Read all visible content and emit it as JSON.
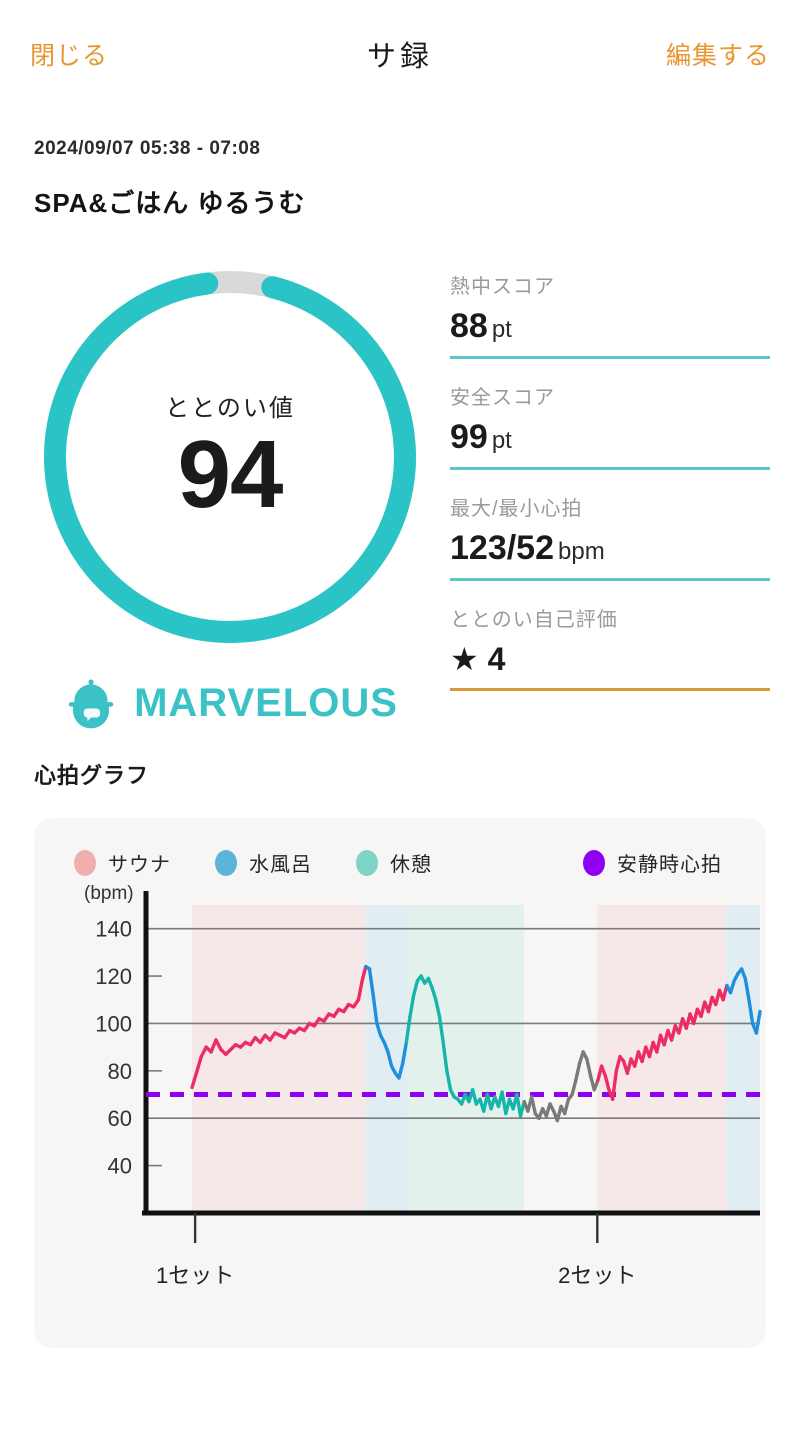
{
  "header": {
    "close_label": "閉じる",
    "title": "サ録",
    "edit_label": "編集する"
  },
  "session": {
    "datetime": "2024/09/07 05:38 - 07:08",
    "venue": "SPA&ごはん ゆるうむ"
  },
  "gauge": {
    "label": "ととのい値",
    "value": "94",
    "percent": 94,
    "track_color": "#D9D9D9",
    "fill_color": "#2BC4C6",
    "rank_text": "MARVELOUS",
    "rank_color": "#3BC2C6",
    "icon": "sauna-hat-character-icon"
  },
  "stats": [
    {
      "label": "熱中スコア",
      "value": "88",
      "unit": "pt",
      "rule_color": "#5CC6C8"
    },
    {
      "label": "安全スコア",
      "value": "99",
      "unit": "pt",
      "rule_color": "#5CC6C8"
    },
    {
      "label": "最大/最小心拍",
      "value": "123/52",
      "unit": "bpm",
      "rule_color": "#5CC6C8"
    },
    {
      "label": "ととのい自己評価",
      "value": "★ 4",
      "unit": "",
      "rule_color": "#D99A3E"
    }
  ],
  "chart_section_title": "心拍グラフ",
  "chart_data": {
    "type": "line",
    "title": "心拍グラフ",
    "ylabel": "(bpm)",
    "xlabel": "",
    "ylim": [
      20,
      150
    ],
    "yticks": [
      40,
      60,
      80,
      100,
      120,
      140
    ],
    "gridlines": [
      60,
      100,
      140
    ],
    "grid": true,
    "legend_position": "top",
    "legend": [
      {
        "name": "サウナ",
        "color": "#EFAFAF"
      },
      {
        "name": "水風呂",
        "color": "#5BB4D9"
      },
      {
        "name": "休憩",
        "color": "#7FD4C8"
      },
      {
        "name": "安静時心拍",
        "color": "#9000F0"
      }
    ],
    "xticks": [
      {
        "label": "1セット",
        "x": 0.08
      },
      {
        "label": "2セット",
        "x": 0.735
      }
    ],
    "resting_hr": 70,
    "resting_hr_color": "#9000F0",
    "phases": [
      {
        "type": "サウナ",
        "x0": 0.075,
        "x1": 0.358,
        "band_color": "#F6DDDE",
        "line_color": "#ED2C64"
      },
      {
        "type": "水風呂",
        "x0": 0.358,
        "x1": 0.425,
        "band_color": "#CDE6F2",
        "line_color": "#1E8FDE"
      },
      {
        "type": "休憩",
        "x0": 0.425,
        "x1": 0.615,
        "band_color": "#D3EDE8",
        "line_color": "#15B5AA"
      },
      {
        "type": "gap",
        "x0": 0.615,
        "x1": 0.735,
        "band_color": "#F7F6F4",
        "line_color": "#7A7A7A"
      },
      {
        "type": "サウナ",
        "x0": 0.735,
        "x1": 0.945,
        "band_color": "#F6DDDE",
        "line_color": "#ED2C64"
      },
      {
        "type": "水風呂",
        "x0": 0.945,
        "x1": 1.0,
        "band_color": "#CDE6F2",
        "line_color": "#1E8FDE"
      }
    ],
    "series": [
      {
        "name": "心拍数",
        "x": [
          0.075,
          0.082,
          0.09,
          0.098,
          0.106,
          0.114,
          0.122,
          0.13,
          0.138,
          0.146,
          0.154,
          0.162,
          0.17,
          0.178,
          0.186,
          0.194,
          0.202,
          0.21,
          0.218,
          0.226,
          0.234,
          0.242,
          0.25,
          0.258,
          0.266,
          0.274,
          0.282,
          0.29,
          0.298,
          0.306,
          0.314,
          0.322,
          0.33,
          0.338,
          0.346,
          0.352,
          0.358,
          0.364,
          0.37,
          0.376,
          0.382,
          0.388,
          0.394,
          0.4,
          0.406,
          0.412,
          0.418,
          0.424,
          0.43,
          0.436,
          0.442,
          0.448,
          0.454,
          0.46,
          0.466,
          0.472,
          0.478,
          0.484,
          0.49,
          0.496,
          0.502,
          0.508,
          0.514,
          0.52,
          0.526,
          0.532,
          0.538,
          0.544,
          0.55,
          0.556,
          0.562,
          0.568,
          0.574,
          0.58,
          0.586,
          0.592,
          0.598,
          0.604,
          0.61,
          0.616,
          0.622,
          0.628,
          0.634,
          0.64,
          0.646,
          0.652,
          0.658,
          0.664,
          0.67,
          0.676,
          0.682,
          0.688,
          0.694,
          0.7,
          0.706,
          0.712,
          0.718,
          0.724,
          0.73,
          0.736,
          0.742,
          0.748,
          0.754,
          0.76,
          0.766,
          0.772,
          0.778,
          0.784,
          0.79,
          0.796,
          0.802,
          0.808,
          0.814,
          0.82,
          0.826,
          0.832,
          0.838,
          0.844,
          0.85,
          0.856,
          0.862,
          0.868,
          0.874,
          0.88,
          0.886,
          0.892,
          0.898,
          0.904,
          0.91,
          0.916,
          0.922,
          0.928,
          0.934,
          0.94,
          0.946,
          0.952,
          0.958,
          0.964,
          0.97,
          0.976,
          0.982,
          0.988,
          0.994,
          1.0
        ],
        "y": [
          73,
          79,
          86,
          90,
          88,
          93,
          89,
          87,
          89,
          91,
          90,
          92,
          91,
          94,
          92,
          95,
          93,
          96,
          95,
          94,
          97,
          96,
          98,
          97,
          100,
          99,
          102,
          101,
          104,
          103,
          106,
          105,
          108,
          107,
          110,
          118,
          124,
          123,
          112,
          100,
          95,
          92,
          88,
          82,
          79,
          77,
          83,
          92,
          103,
          112,
          118,
          120,
          117,
          119,
          115,
          110,
          103,
          92,
          80,
          72,
          69,
          68,
          66,
          70,
          67,
          72,
          66,
          68,
          63,
          70,
          64,
          69,
          65,
          71,
          62,
          68,
          64,
          70,
          61,
          67,
          63,
          69,
          62,
          60,
          64,
          61,
          66,
          63,
          59,
          65,
          62,
          68,
          70,
          76,
          83,
          88,
          85,
          78,
          72,
          76,
          82,
          78,
          72,
          68,
          80,
          86,
          84,
          79,
          85,
          82,
          88,
          84,
          90,
          86,
          92,
          88,
          95,
          91,
          97,
          93,
          99,
          96,
          102,
          98,
          104,
          100,
          106,
          103,
          109,
          105,
          111,
          108,
          114,
          110,
          116,
          113,
          118,
          121,
          123,
          119,
          110,
          100,
          96,
          105,
          112,
          117
        ]
      }
    ]
  }
}
